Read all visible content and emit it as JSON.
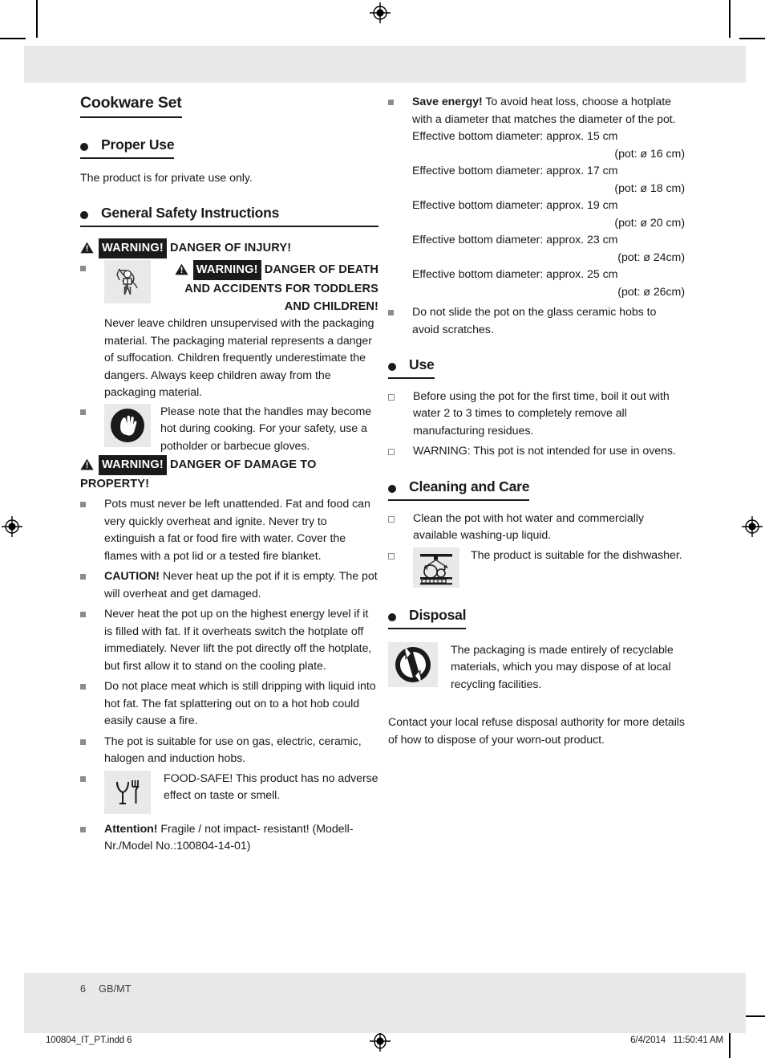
{
  "document": {
    "title": "Cookware Set",
    "footer": {
      "page_number": "6",
      "locale": "GB/MT",
      "file_name": "100804_IT_PT.indd   6",
      "print_date": "6/4/2014",
      "print_time": "11:50:41 AM"
    }
  },
  "left_column": {
    "proper_use": {
      "heading": "Proper Use",
      "body": "The product is for private use only."
    },
    "general_safety": {
      "heading": "General Safety Instructions",
      "warning_injury": {
        "tag": "WARNING!",
        "text": "DANGER OF INJURY!"
      },
      "warning_children": {
        "tag": "WARNING!",
        "text": "DANGER OF DEATH AND ACCIDENTS FOR TODDLERS AND CHILDREN!",
        "icon": "child-suffocation-icon",
        "body": "Never leave children unsupervised with the packaging material. The packaging material represents a danger of suffocation. Children frequently underestimate the dangers. Always keep children away from the packaging material."
      },
      "handles_hot": {
        "icon": "glove-icon",
        "body": "Please note that the handles may become hot during cooking. For your safety, use a potholder or barbecue gloves."
      },
      "warning_property": {
        "tag": "WARNING!",
        "text": "DANGER OF DAMAGE TO PROPERTY!"
      },
      "items": [
        {
          "lead": "",
          "text": "Pots must never be left unattended. Fat and food can very quickly overheat and ignite. Never try to extinguish a fat or food fire with water. Cover the flames with a pot lid or a tested fire blanket."
        },
        {
          "lead": "CAUTION!",
          "text": "Never heat up the pot if it is empty. The pot will overheat and get damaged."
        },
        {
          "lead": "",
          "text": "Never heat the pot up on the highest energy level if it is filled with fat. If it overheats switch the hotplate off immediately. Never lift the pot directly off the hotplate, but first allow it to stand on the cooling plate."
        },
        {
          "lead": "",
          "text": "Do not place meat which is still dripping with liquid into hot fat. The fat splattering out on to a hot hob could easily cause a fire."
        },
        {
          "lead": "",
          "text": "The pot is suitable for use on gas, electric, ceramic, halogen and induction hobs."
        }
      ],
      "food_safe": {
        "icon": "food-safe-icon",
        "text": "FOOD-SAFE! This product has no adverse effect on taste or smell."
      },
      "attention": {
        "lead": "Attention!",
        "text": "Fragile / not impact- resistant! (Modell-Nr./Model No.:100804-14-01)"
      }
    }
  },
  "right_column": {
    "save_energy": {
      "lead": "Save energy!",
      "text": "To avoid heat loss, choose a hotplate with a diameter that matches the diameter of the pot.",
      "diameters": [
        {
          "effective": "Effective bottom diameter: approx. 15 cm",
          "pot": "(pot: ø 16 cm)"
        },
        {
          "effective": "Effective bottom diameter: approx. 17 cm",
          "pot": "(pot: ø 18 cm)"
        },
        {
          "effective": "Effective bottom diameter: approx. 19 cm",
          "pot": "(pot: ø 20 cm)"
        },
        {
          "effective": "Effective bottom diameter: approx. 23 cm",
          "pot": "(pot: ø 24cm)"
        },
        {
          "effective": "Effective bottom diameter: approx. 25 cm",
          "pot": "(pot: ø 26cm)"
        }
      ]
    },
    "no_slide": "Do not slide the pot on the glass ceramic hobs to avoid scratches.",
    "use": {
      "heading": "Use",
      "items": [
        "Before using the pot for the first time, boil it out with water 2 to 3 times to completely remove all manufacturing residues.",
        "WARNING: This pot is not intended for use in ovens."
      ]
    },
    "cleaning": {
      "heading": "Cleaning and Care",
      "item_clean": "Clean the pot with hot water and commercially available washing-up liquid.",
      "dishwasher": {
        "icon": "dishwasher-icon",
        "text": "The product is suitable for the dishwasher."
      }
    },
    "disposal": {
      "heading": "Disposal",
      "recycle": {
        "icon": "green-dot-recycle-icon",
        "text": "The packaging is made entirely of recyclable materials, which you may dispose of at local recycling facilities."
      },
      "contact": "Contact your local refuse disposal authority for more details of how to dispose of your worn-out product."
    }
  },
  "colors": {
    "band": "#e8e8e8",
    "bullet": "#8c8c8c",
    "text": "#1a1a1a",
    "icon_tile": "#e9e9e9"
  }
}
